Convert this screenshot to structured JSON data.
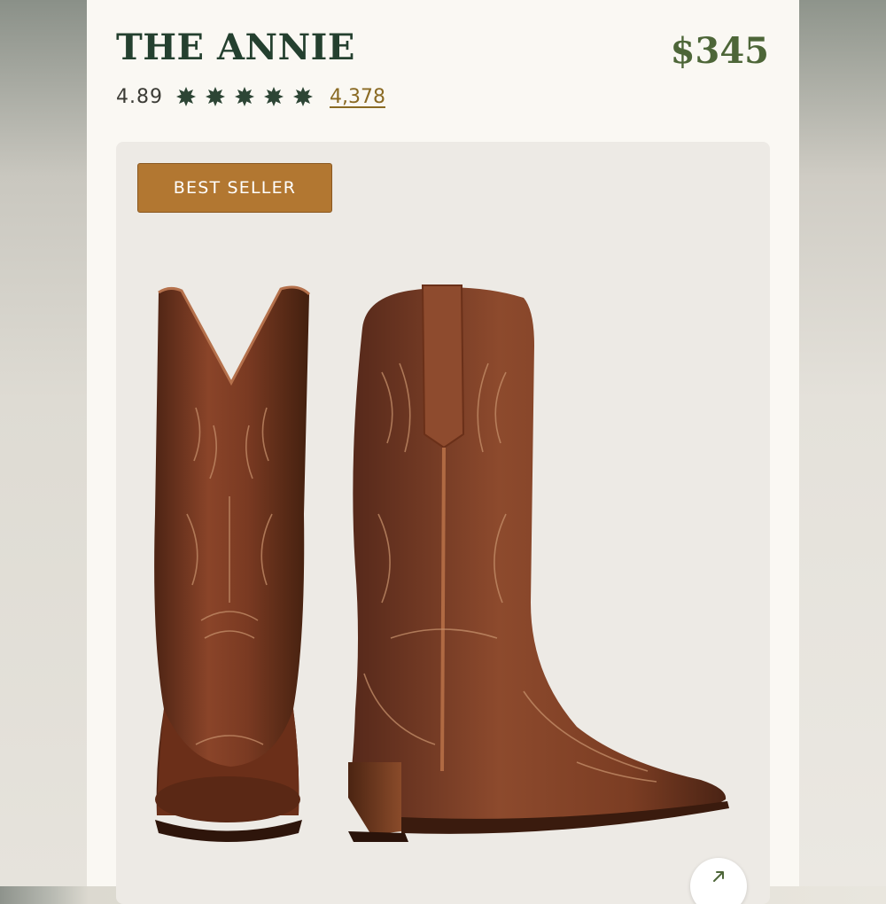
{
  "product": {
    "title": "THE ANNIE",
    "price": "$345",
    "rating": "4.89",
    "rating_stars": 5,
    "review_count": "4,378",
    "badge": "BEST SELLER"
  },
  "colors": {
    "title": "#24402f",
    "price": "#4d6638",
    "star": "#2d4535",
    "review_link": "#8a6a23",
    "badge_bg": "#b27731",
    "boot_leather": "#7a3a22"
  },
  "icons": {
    "star": "star-icon",
    "expand": "expand-arrow-icon"
  }
}
